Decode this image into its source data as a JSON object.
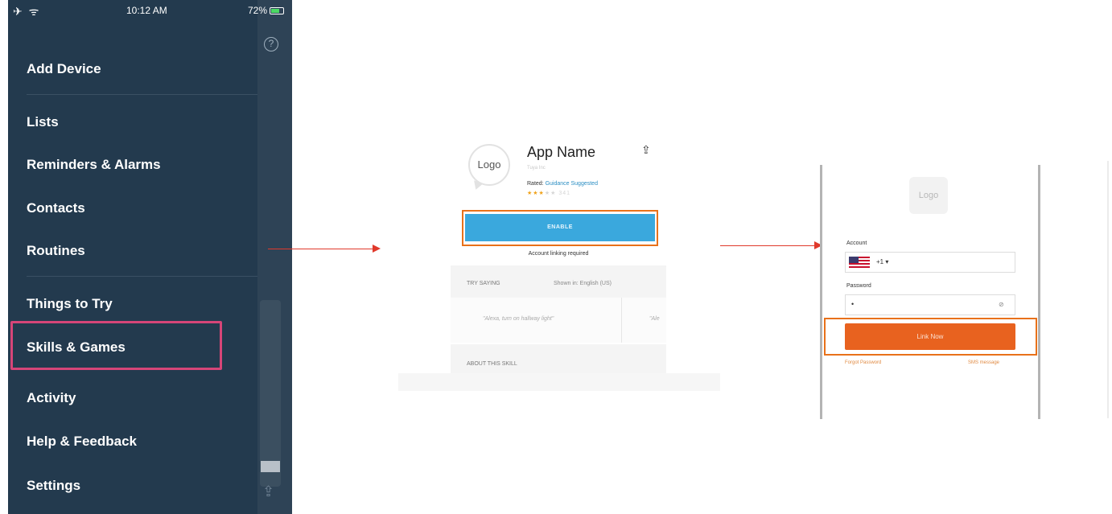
{
  "status_bar": {
    "left_icons": "✈ ᯤ",
    "time": "10:12 AM",
    "battery": "72%"
  },
  "menu": {
    "items": [
      {
        "label": "Add Device"
      },
      {
        "label": "Lists"
      },
      {
        "label": "Reminders & Alarms"
      },
      {
        "label": "Contacts"
      },
      {
        "label": "Routines"
      },
      {
        "label": "Things to Try"
      },
      {
        "label": "Skills & Games"
      },
      {
        "label": "Activity"
      },
      {
        "label": "Help & Feedback"
      },
      {
        "label": "Settings"
      }
    ],
    "highlighted": "Skills & Games",
    "highlight_color": "#d64578"
  },
  "skill_page": {
    "logo": "Logo",
    "app_name": "App Name",
    "developer": "Tuya Inc",
    "rated_prefix": "Rated:",
    "rated_link": "Guidance Suggested",
    "stars_filled": "★★★",
    "stars_empty": "★★",
    "review_count": "341",
    "enable_label": "ENABLE",
    "linking_note": "Account linking required",
    "try_saying": "TRY SAYING",
    "shown_in": "Shown in: English (US)",
    "phrase_1": "\"Alexa, turn on hallway light\"",
    "phrase_2": "\"Ale",
    "about": "ABOUT THIS SKILL",
    "enable_color": "#3aa8dd",
    "highlight_color": "#e8711a"
  },
  "login_page": {
    "logo": "Logo",
    "account_label": "Account",
    "country_code": "+1 ▾",
    "password_label": "Password",
    "password_value": "•",
    "link_button": "Link Now",
    "forgot": "Forgot Password",
    "sms": "SMS message",
    "button_color": "#e8621f"
  }
}
